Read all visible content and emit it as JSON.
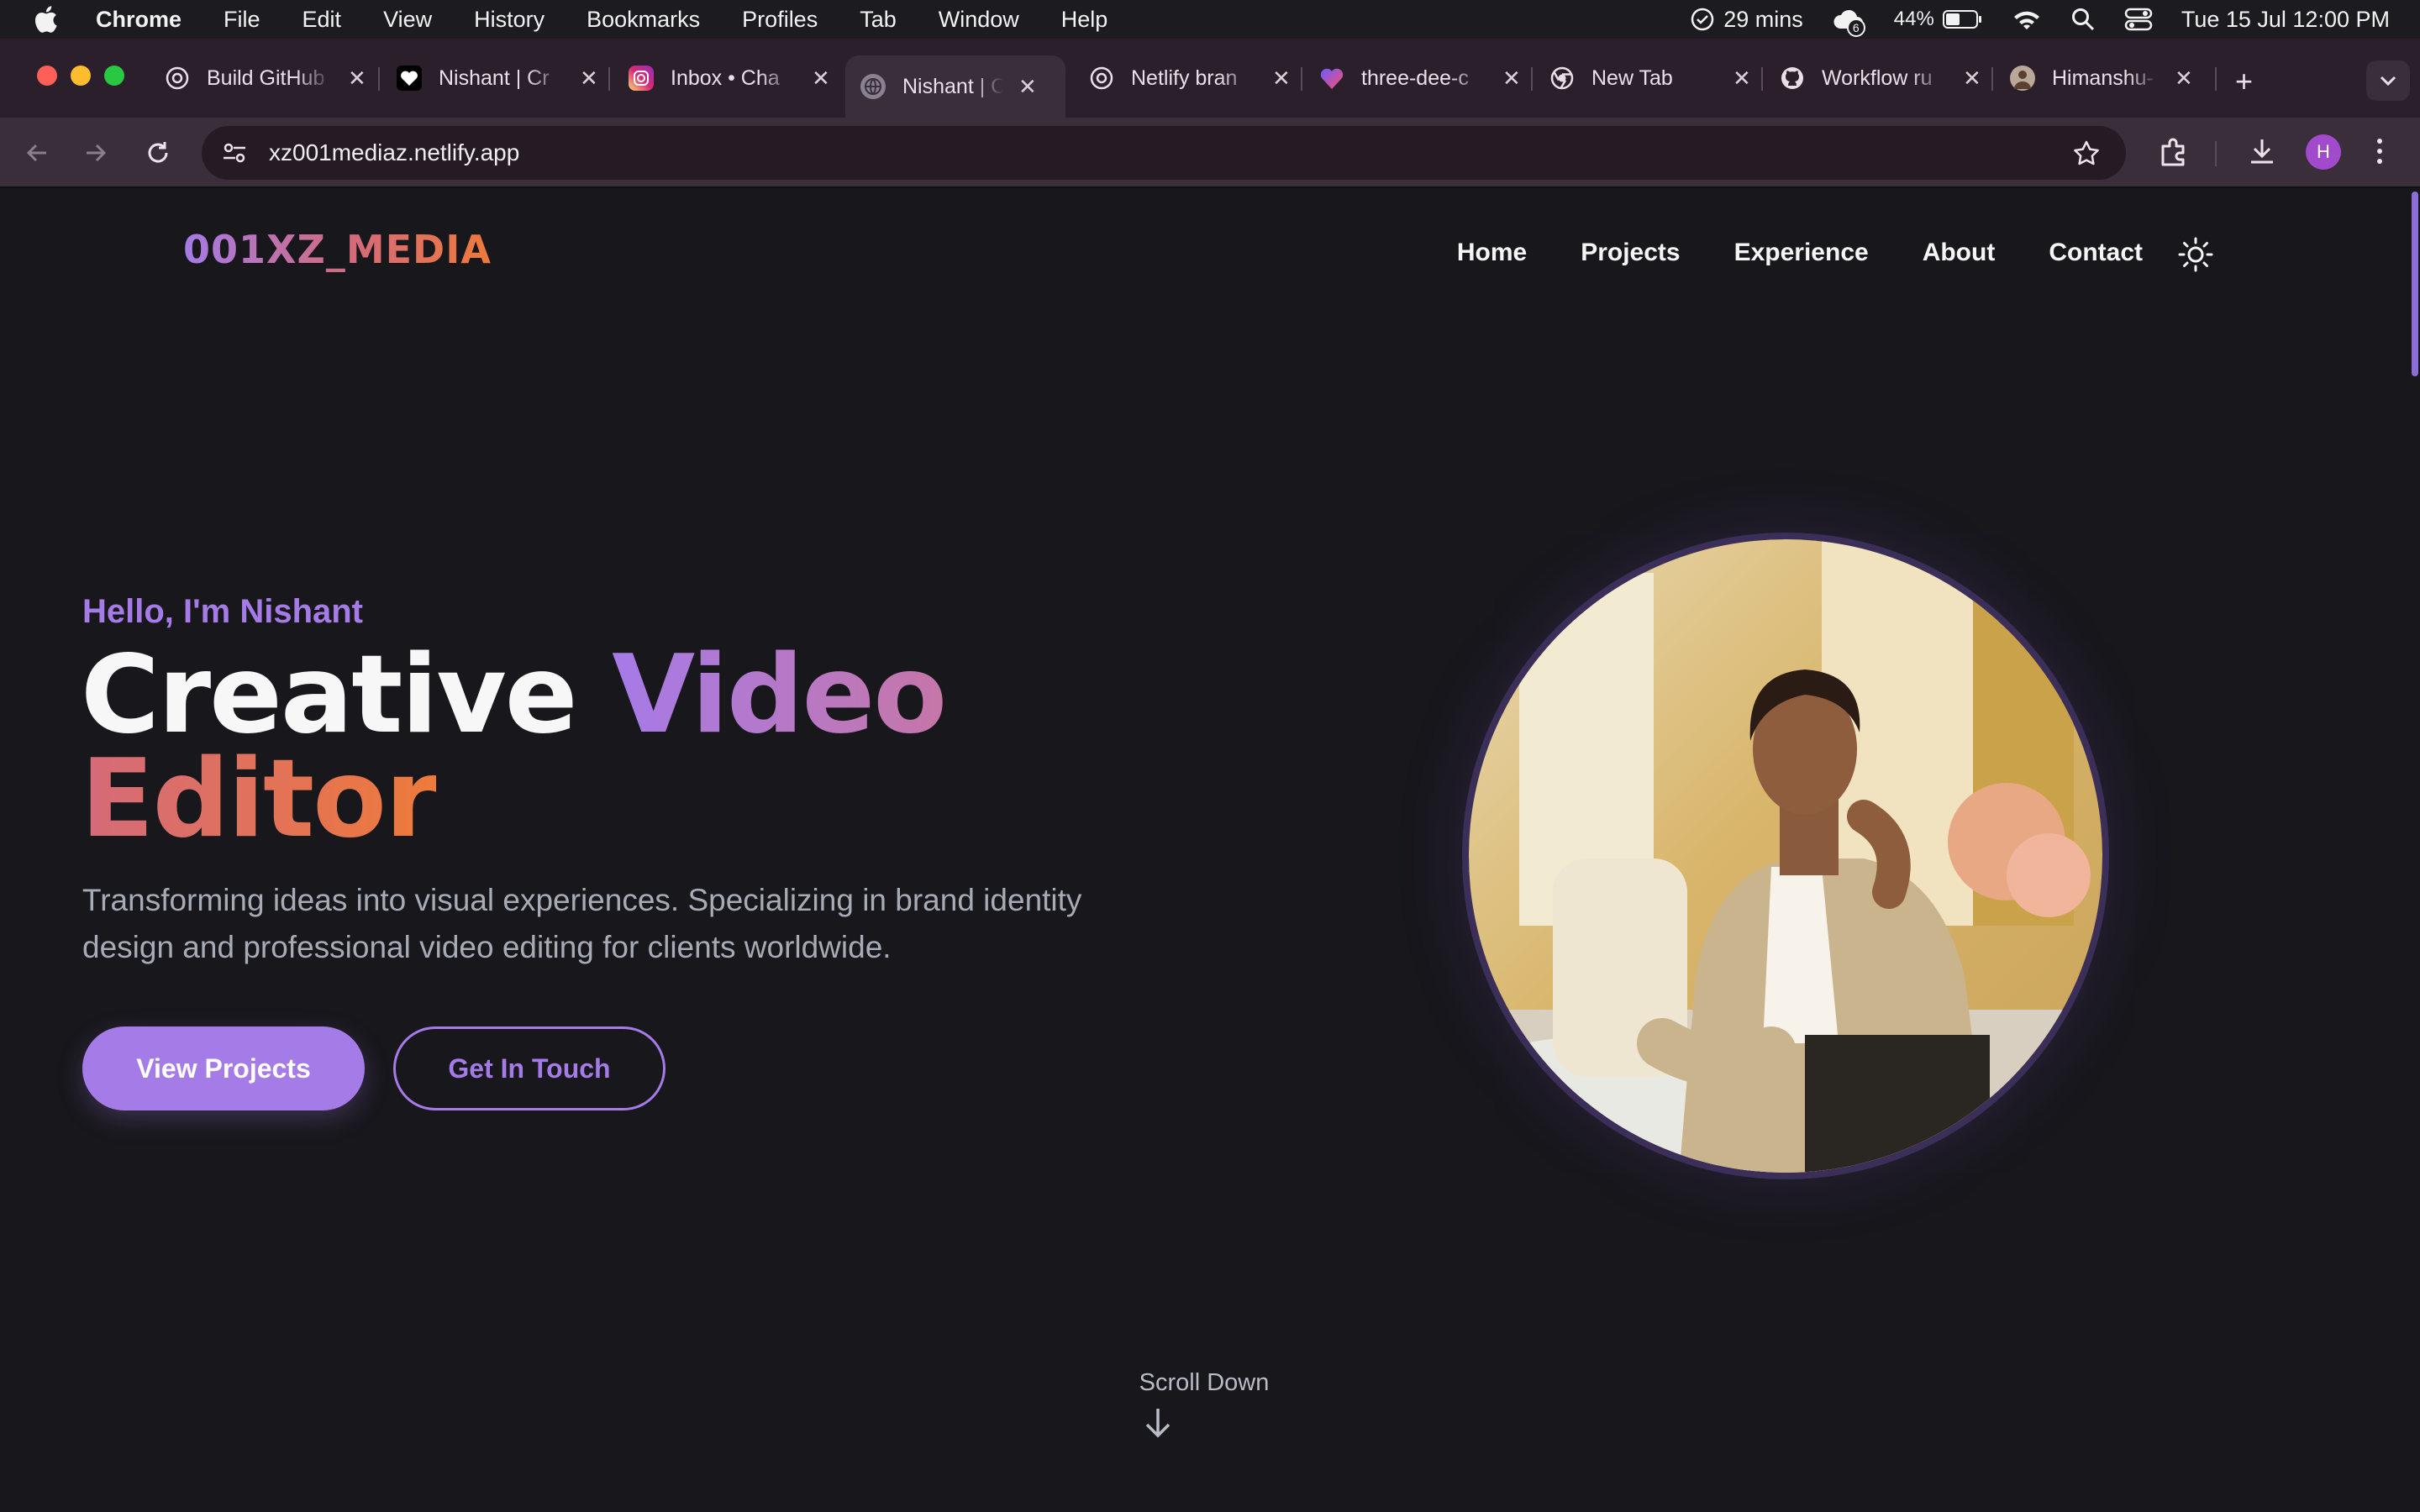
{
  "menubar": {
    "app_name": "Chrome",
    "items": [
      "File",
      "Edit",
      "View",
      "History",
      "Bookmarks",
      "Profiles",
      "Tab",
      "Window",
      "Help"
    ],
    "focus_time": "29 mins",
    "notification_count": "6",
    "battery": "44%",
    "datetime": "Tue 15 Jul  12:00 PM"
  },
  "tabs": [
    {
      "title": "Build GitHub",
      "icon": "openai-icon"
    },
    {
      "title": "Nishant | Cr",
      "icon": "heart-icon"
    },
    {
      "title": "Inbox • Cha",
      "icon": "instagram-icon"
    },
    {
      "title": "Nishant | Cr",
      "icon": "globe-icon",
      "active": true
    },
    {
      "title": "Netlify bran",
      "icon": "openai-icon"
    },
    {
      "title": "three-dee-c",
      "icon": "heart-gradient-icon"
    },
    {
      "title": "New Tab",
      "icon": "chrome-icon"
    },
    {
      "title": "Workflow ru",
      "icon": "github-icon"
    },
    {
      "title": "Himanshu-",
      "icon": "avatar-icon"
    }
  ],
  "toolbar": {
    "url": "xz001mediaz.netlify.app",
    "profile_initial": "H"
  },
  "site": {
    "logo": "001XZ_MEDIA",
    "nav": [
      "Home",
      "Projects",
      "Experience",
      "About",
      "Contact"
    ],
    "hero": {
      "greeting": "Hello, I'm Nishant",
      "headline_word1": "Creative",
      "headline_word2": "Video",
      "headline_word3": "Editor",
      "subtitle": "Transforming ideas into visual experiences. Specializing in brand identity design and professional video editing for clients worldwide.",
      "primary_button": "View Projects",
      "secondary_button": "Get In Touch",
      "scroll_hint": "Scroll Down"
    }
  },
  "colors": {
    "accent": "#a57be8",
    "accent_orange": "#ee7a3a",
    "page_bg": "#18171c"
  }
}
